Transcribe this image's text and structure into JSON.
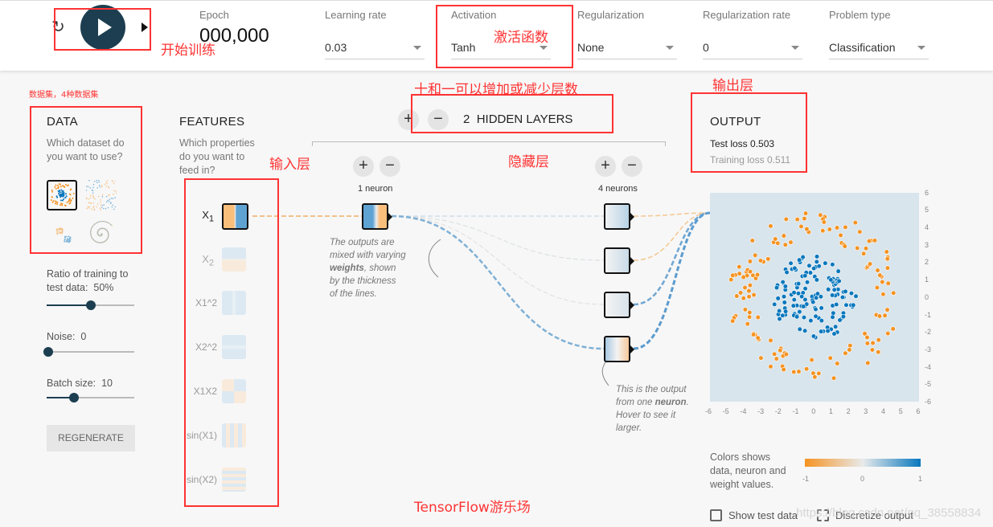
{
  "header": {
    "epoch_label": "Epoch",
    "epoch_value": "000,000",
    "dropdowns": [
      {
        "label": "Learning rate",
        "value": "0.03"
      },
      {
        "label": "Activation",
        "value": "Tanh"
      },
      {
        "label": "Regularization",
        "value": "None"
      },
      {
        "label": "Regularization rate",
        "value": "0"
      },
      {
        "label": "Problem type",
        "value": "Classification"
      }
    ],
    "icons": {
      "reset": "reset-icon",
      "play": "play-icon",
      "step": "step-icon"
    }
  },
  "annotations": {
    "start": "开始训练",
    "activation": "激活函数",
    "dataset": "数据集，4种数据集",
    "layers": "十和一可以增加或减少层数",
    "output": "输出层",
    "input": "输入层",
    "hidden": "隐藏层",
    "footer": "TensorFlow游乐场"
  },
  "data": {
    "title": "DATA",
    "subtitle": "Which dataset do you want to use?",
    "ratio_label": "Ratio of training to test data:",
    "ratio_value": "50%",
    "ratio_fraction": 0.5,
    "noise_label": "Noise:",
    "noise_value": "0",
    "noise_fraction": 0,
    "batch_label": "Batch size:",
    "batch_value": "10",
    "batch_fraction": 0.3,
    "regenerate": "REGENERATE"
  },
  "features": {
    "title": "FEATURES",
    "subtitle": "Which properties do you want to feed in?",
    "items": [
      "X1",
      "X2",
      "X1^2",
      "X2^2",
      "X1X2",
      "sin(X1)",
      "sin(X2)"
    ]
  },
  "network": {
    "hidden_count": "2",
    "hidden_label": "HIDDEN LAYERS",
    "layer1": "1 neuron",
    "layer2": "4 neurons",
    "note1_a": "The outputs are mixed with varying ",
    "note1_b": "weights",
    "note1_c": ", shown by the thickness of the lines.",
    "note2_a": "This is the output from one ",
    "note2_b": "neuron",
    "note2_c": ". Hover to see it larger."
  },
  "output": {
    "title": "OUTPUT",
    "test_loss_label": "Test loss",
    "test_loss": "0.503",
    "train_loss_label": "Training loss",
    "train_loss": "0.511",
    "axis_ticks": [
      "-6",
      "-5",
      "-4",
      "-3",
      "-2",
      "-1",
      "0",
      "1",
      "2",
      "3",
      "4",
      "5",
      "6"
    ],
    "legend_text": "Colors shows data, neuron and weight values.",
    "legend_ticks": [
      "-1",
      "0",
      "1"
    ],
    "show_test": "Show test data",
    "discretize": "Discretize output",
    "watermark": "https://blog.csdn.net/qq_38558834"
  },
  "colors": {
    "orange": "#f59322",
    "blue": "#0877bd",
    "dark": "#1c3e50"
  }
}
